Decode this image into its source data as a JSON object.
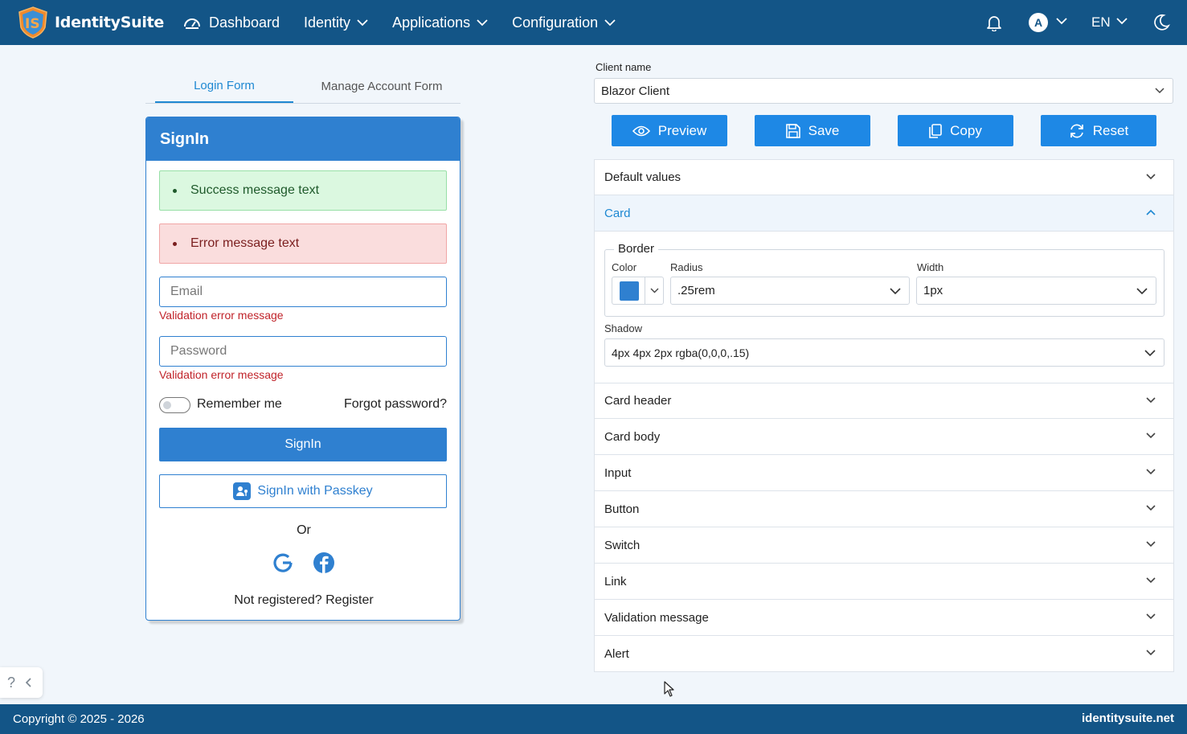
{
  "brand": {
    "name": "IdentitySuite"
  },
  "nav": {
    "dashboard": "Dashboard",
    "identity": "Identity",
    "applications": "Applications",
    "configuration": "Configuration",
    "avatar_initial": "A",
    "language": "EN"
  },
  "preview": {
    "tabs": {
      "login": "Login Form",
      "manage": "Manage Account Form"
    },
    "card_title": "SignIn",
    "success_alert": "Success message text",
    "error_alert": "Error message text",
    "email_placeholder": "Email",
    "password_placeholder": "Password",
    "validation_email": "Validation error message",
    "validation_password": "Validation error message",
    "remember": "Remember me",
    "forgot": "Forgot password?",
    "signin_button": "SignIn",
    "passkey_button": "SignIn with Passkey",
    "or": "Or",
    "register": "Not registered? Register"
  },
  "help": {
    "icon": "?"
  },
  "editor": {
    "client_label": "Client name",
    "client_value": "Blazor Client",
    "buttons": {
      "preview": "Preview",
      "save": "Save",
      "copy": "Copy",
      "reset": "Reset"
    },
    "sections": {
      "default_values": "Default values",
      "card": "Card",
      "card_header": "Card header",
      "card_body": "Card body",
      "input": "Input",
      "button": "Button",
      "switch": "Switch",
      "link": "Link",
      "validation_message": "Validation message",
      "alert": "Alert"
    },
    "card": {
      "border_legend": "Border",
      "color_label": "Color",
      "color_value": "#2f80d0",
      "radius_label": "Radius",
      "radius_value": ".25rem",
      "width_label": "Width",
      "width_value": "1px",
      "shadow_label": "Shadow",
      "shadow_value": "4px 4px 2px rgba(0,0,0,.15)"
    }
  },
  "footer": {
    "copyright": "Copyright © 2025 - 2026",
    "site": "identitysuite.net"
  },
  "colors": {
    "topbar": "#135587",
    "primary": "#2f80d0",
    "action": "#1e88e5"
  }
}
